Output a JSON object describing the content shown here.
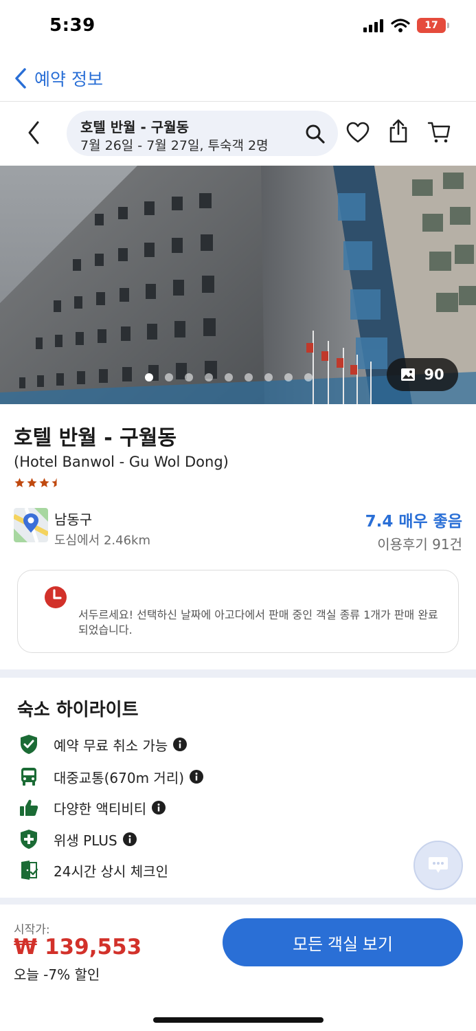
{
  "status_bar": {
    "time": "5:39",
    "battery": "17"
  },
  "back_nav": {
    "label": "예약 정보"
  },
  "search": {
    "title": "호텔 반월 - 구월동",
    "subtitle": "7월 26일 - 7월 27일, 투숙객 2명"
  },
  "hero": {
    "photo_count": "90",
    "slide_count": 9,
    "active_slide": 1
  },
  "hotel": {
    "name": "호텔 반월 - 구월동",
    "name_en": "(Hotel Banwol - Gu Wol Dong)",
    "star_rating": 3.5,
    "district": "남동구",
    "distance": "도심에서 2.46km",
    "score_text": "7.4 매우 좋음",
    "reviews": "이용후기 91건"
  },
  "alert": {
    "text": "서두르세요! 선택하신 날짜에 아고다에서 판매 중인 객실 종류 1개가 판매 완료되었습니다."
  },
  "highlights": {
    "title": "숙소 하이라이트",
    "items": [
      {
        "label": "예약 무료 취소 가능",
        "icon": "shield-check-icon",
        "info": true
      },
      {
        "label": "대중교통(670m 거리)",
        "icon": "bus-icon",
        "info": true
      },
      {
        "label": "다양한 액티비티",
        "icon": "thumbs-up-icon",
        "info": true
      },
      {
        "label": "위생 PLUS",
        "icon": "health-shield-icon",
        "info": true
      },
      {
        "label": "24시간 상시 체크인",
        "icon": "door-check-icon",
        "info": false
      }
    ]
  },
  "bottom": {
    "start_label": "시작가:",
    "price": "₩ 139,553",
    "discount": "오늘 -7% 할인",
    "cta": "모든 객실 보기"
  },
  "colors": {
    "accent": "#2a6fd6",
    "price": "#d2312a",
    "highlight_icon": "#1b6b35",
    "star": "#c0490f"
  }
}
